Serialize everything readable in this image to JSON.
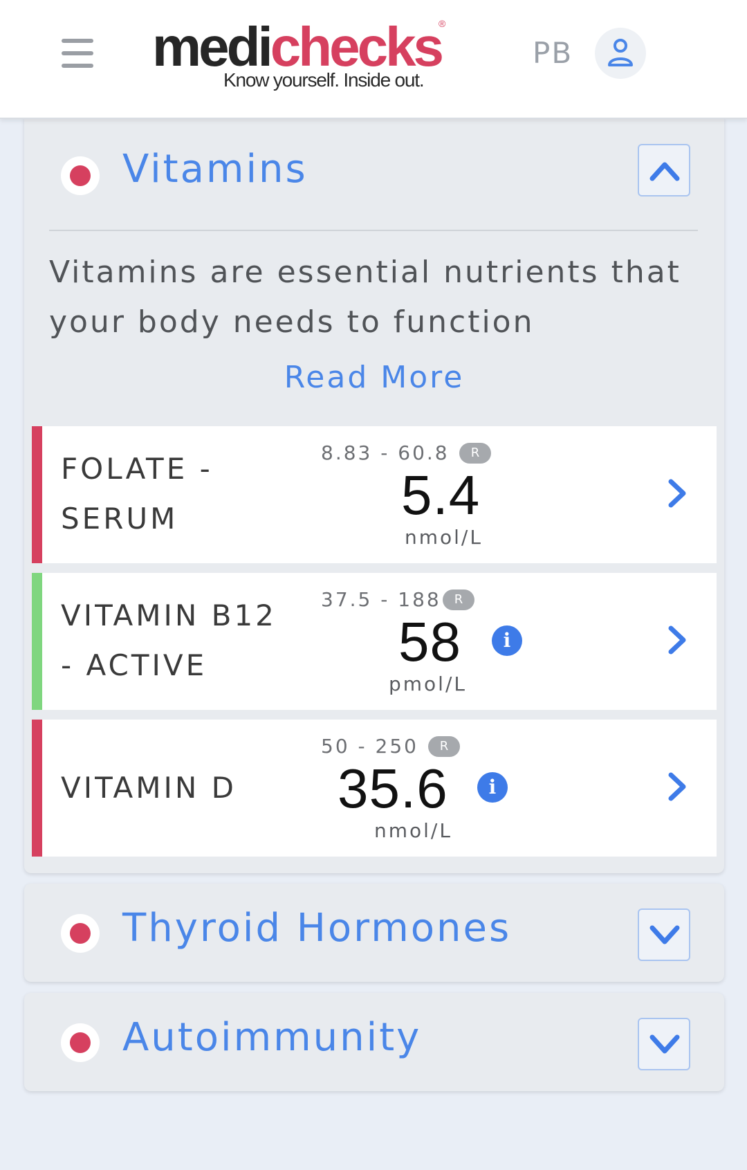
{
  "header": {
    "logo_part1": "medi",
    "logo_part2": "checks",
    "logo_reg": "®",
    "tagline": "Know yourself. Inside out.",
    "user_initials": "PB",
    "menu_icon": "hamburger-icon",
    "avatar_icon": "user-icon"
  },
  "vitamins": {
    "title": "Vitamins",
    "status_color": "#d6405f",
    "description": "Vitamins are essential nutrients that your body needs to function",
    "read_more": "Read More",
    "toggle_icon": "chevron-up-icon",
    "results": [
      {
        "name_line1": "FOLATE -",
        "name_line2": "SERUM",
        "range": "8.83 - 60.8",
        "badge": "R",
        "value": "5.4",
        "unit": "nmol/L",
        "status_color": "#d6405f",
        "has_info": false
      },
      {
        "name_line1": "VITAMIN B12",
        "name_line2": "- ACTIVE",
        "range": "37.5 - 188",
        "badge": "R",
        "value": "58",
        "unit": "pmol/L",
        "status_color": "#7fd67f",
        "has_info": true,
        "info_glyph": "i"
      },
      {
        "name_line1": "VITAMIN D",
        "name_line2": "",
        "range": "50 - 250",
        "badge": "R",
        "value": "35.6",
        "unit": "nmol/L",
        "status_color": "#d6405f",
        "has_info": true,
        "info_glyph": "i"
      }
    ]
  },
  "thyroid": {
    "title": "Thyroid Hormones",
    "status_color": "#d6405f",
    "toggle_icon": "chevron-down-icon"
  },
  "autoimmunity": {
    "title": "Autoimmunity",
    "status_color": "#d6405f",
    "toggle_icon": "chevron-down-icon"
  },
  "colors": {
    "accent_blue": "#4a86e8",
    "brand_pink": "#d6405f",
    "normal_green": "#7fd67f"
  }
}
